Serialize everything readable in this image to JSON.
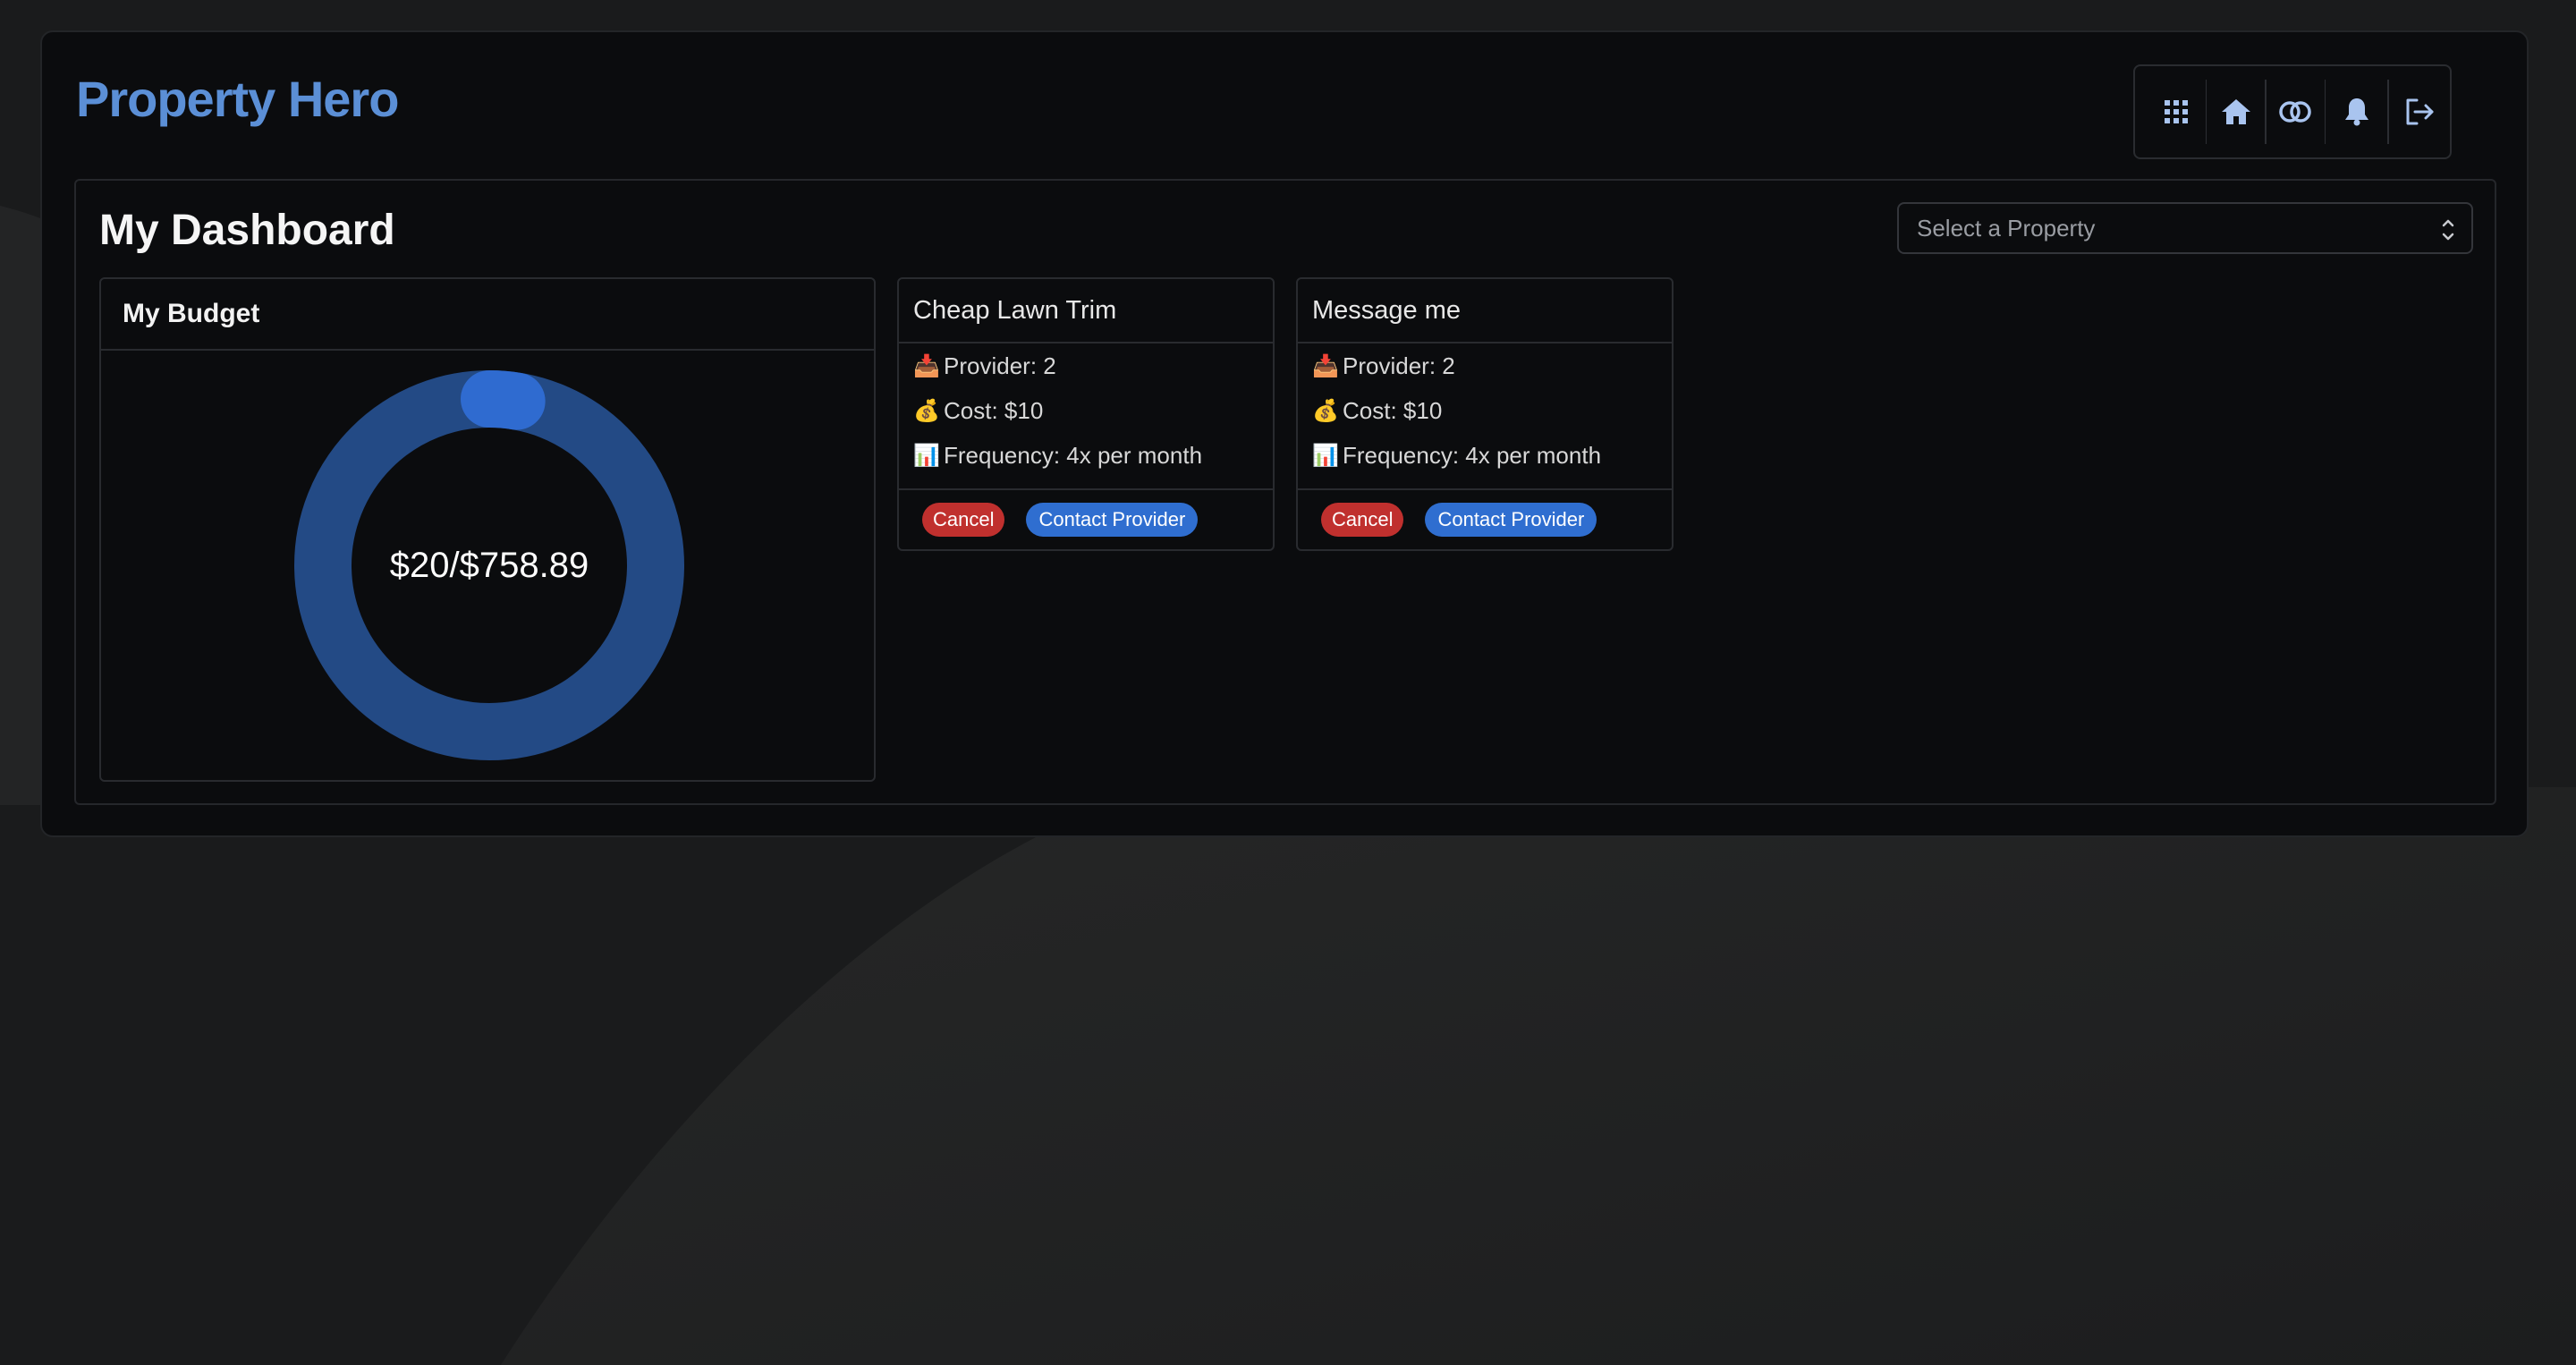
{
  "app": {
    "title": "Property Hero"
  },
  "nav": {
    "icons": [
      "grid-icon",
      "home-icon",
      "rings-icon",
      "bell-icon",
      "logout-icon"
    ]
  },
  "dashboard": {
    "title": "My Dashboard",
    "property_select": {
      "placeholder": "Select a Property"
    }
  },
  "budget": {
    "title": "My Budget",
    "label": "$20/$758.89",
    "spent": 20,
    "total": 758.89,
    "colors": {
      "track": "#234a85",
      "progress": "#2f6bd0"
    }
  },
  "services": [
    {
      "title": "Cheap Lawn Trim",
      "provider": "Provider: 2",
      "cost": "Cost: $10",
      "frequency": "Frequency: 4x per month",
      "cancel_label": "Cancel",
      "contact_label": "Contact Provider"
    },
    {
      "title": "Message me",
      "provider": "Provider: 2",
      "cost": "Cost: $10",
      "frequency": "Frequency: 4x per month",
      "cancel_label": "Cancel",
      "contact_label": "Contact Provider"
    }
  ],
  "colors": {
    "brand": "#5b8fd6",
    "cancel": "#c0302e",
    "contact": "#2f6ed0"
  }
}
